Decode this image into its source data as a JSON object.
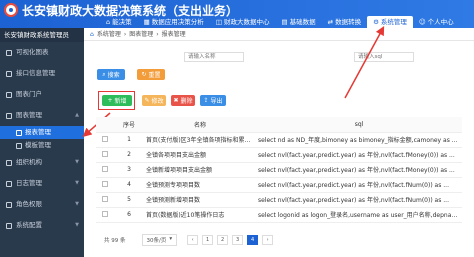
{
  "header": {
    "title": "长安镇财政大数据决策系统（支出业务）",
    "nav": [
      {
        "icon": "home-icon",
        "label": "能决策"
      },
      {
        "icon": "dashboard-icon",
        "label": "数据应用决策分析"
      },
      {
        "icon": "database-icon",
        "label": "财政大数据中心"
      },
      {
        "icon": "grid-icon",
        "label": "基础数据"
      },
      {
        "icon": "sync-icon",
        "label": "数据转换"
      },
      {
        "icon": "gear-icon",
        "label": "系统管理"
      },
      {
        "icon": "user-icon",
        "label": "个人中心"
      }
    ]
  },
  "sidebar": {
    "system_name": "长安镇财政系统管理员",
    "items": [
      {
        "label": "可视化图表"
      },
      {
        "label": "接口信息管理"
      },
      {
        "label": "图表门户"
      },
      {
        "label": "图表管理"
      },
      {
        "label": "报表管理"
      },
      {
        "label": "模板管理"
      },
      {
        "label": "组织机构"
      },
      {
        "label": "日志管理"
      },
      {
        "label": "角色权限"
      },
      {
        "label": "系统配置"
      }
    ]
  },
  "breadcrumb": [
    "系统管理",
    "图表管理",
    "报表管理"
  ],
  "filters": {
    "name_placeholder": "请输入名称",
    "sql_placeholder": "请输入sql"
  },
  "buttons": {
    "search": "搜索",
    "reset": "重置",
    "add": "新增",
    "edit": "修改",
    "delete": "删除",
    "export": "导出"
  },
  "table": {
    "headers": [
      "序号",
      "名称",
      "sql"
    ],
    "rows": [
      {
        "no": "1",
        "name": "首页(支付版)区3年全镇各项指标和累计支...",
        "sql": "select nd as ND_年度,bimoney as bimoney_指标金额,camoney as ..."
      },
      {
        "no": "2",
        "name": "全镇各项项目支出金额",
        "sql": "select nvl(fact.year,predict.year) as 年份,nvl(fact.fMoney(0)) as ..."
      },
      {
        "no": "3",
        "name": "全镇新增项项目支出金额",
        "sql": "select nvl(fact.year,predict.year) as 年份,nvl(fact.fMoney(0)) as ..."
      },
      {
        "no": "4",
        "name": "全镇预测专项项目数",
        "sql": "select nvl(fact.year,predict.year) as 年份,nvl(fact.fNum(0)) as ..."
      },
      {
        "no": "5",
        "name": "全镇预测新增项目数",
        "sql": "select nvl(fact.year,predict.year) as 年份,nvl(fact.fNum(0)) as ..."
      },
      {
        "no": "6",
        "name": "首页(数据版)近10笔操作日志",
        "sql": "select logonid as logon_登录名,username as user_用户名称,depname..."
      }
    ]
  },
  "pager": {
    "total": "共 99 条",
    "page_size": "30条/页",
    "pages": [
      "1",
      "2",
      "3",
      "4"
    ]
  },
  "colors": {
    "header": "#1d62d3",
    "sidebar": "#2a3a4d",
    "active": "#1f6fde",
    "search_btn": "#3a8ee6",
    "reset_btn": "#f39c3a",
    "add_btn": "#2dbd5b",
    "delete_btn": "#e8544a",
    "annotation": "#e53935"
  }
}
